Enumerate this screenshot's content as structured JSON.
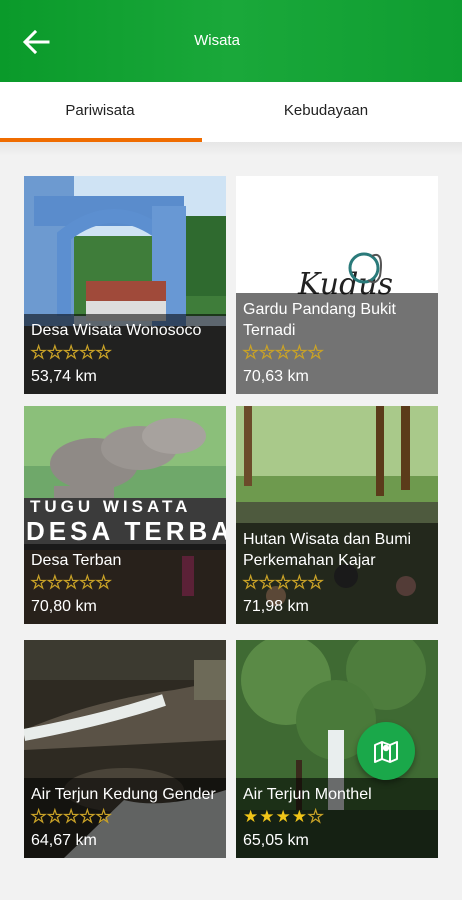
{
  "app_bar": {
    "title": "Wisata",
    "back_icon": "arrow-left-icon"
  },
  "tabs": [
    {
      "label": "Pariwisata",
      "active": true
    },
    {
      "label": "Kebudayaan",
      "active": false
    }
  ],
  "colors": {
    "app_bar": "#0f9d31",
    "tab_indicator": "#ef6c00",
    "star": "#f0c419",
    "fab": "#1aa84a"
  },
  "places": [
    {
      "name": "Desa Wisata Wonosoco",
      "rating": 0,
      "distance": "53,74 km"
    },
    {
      "name": "Gardu Pandang Bukit Ternadi",
      "rating": 0,
      "distance": "70,63 km"
    },
    {
      "name": "Desa Terban",
      "rating": 0,
      "distance": "70,80 km"
    },
    {
      "name": "Hutan Wisata dan Bumi Perkemahan Kajar",
      "rating": 0,
      "distance": "71,98 km"
    },
    {
      "name": "Air Terjun Kedung Gender",
      "rating": 0,
      "distance": "64,67 km"
    },
    {
      "name": "Air Terjun Monthel",
      "rating": 4,
      "distance": "65,05 km"
    }
  ],
  "rating_max": 5,
  "image_text": {
    "logo": "Kudus",
    "monument_line1": "TUGU WISATA",
    "monument_line2": "DESA TERBAN"
  },
  "fab": {
    "icon": "map-pin-icon"
  }
}
